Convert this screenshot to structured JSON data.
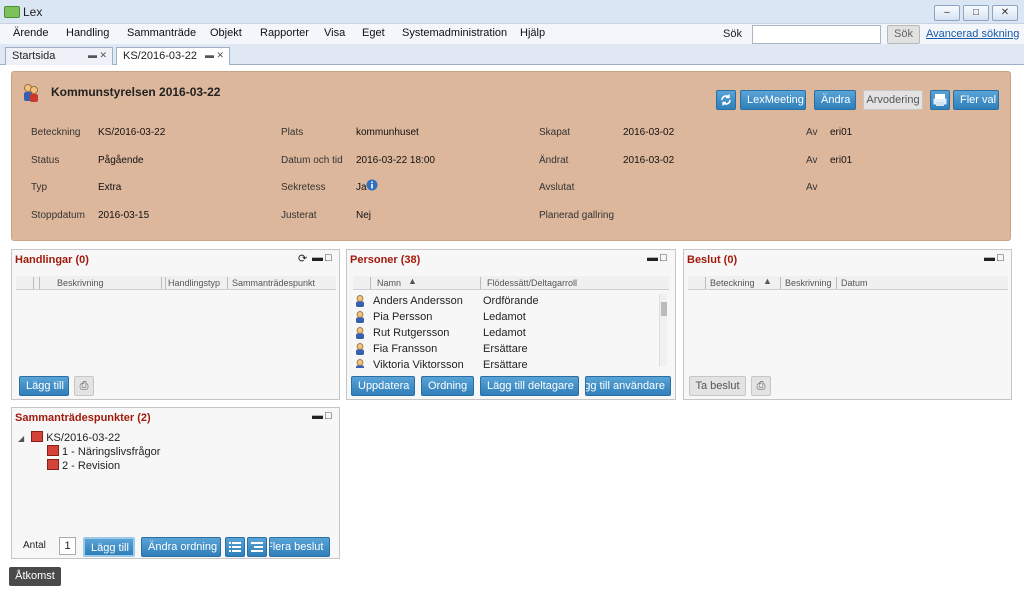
{
  "window": {
    "title": "Lex"
  },
  "menu": [
    "Ärende",
    "Handling",
    "Sammanträde",
    "Objekt",
    "Rapporter",
    "Visa",
    "Eget",
    "Systemadministration",
    "Hjälp"
  ],
  "search": {
    "label": "Sök",
    "value": "",
    "button": "Sök",
    "advanced": "Avancerad sökning"
  },
  "tabs": [
    "Startsida",
    "KS/2016-03-22"
  ],
  "header": {
    "title": "Kommunstyrelsen 2016-03-22",
    "buttons": {
      "lexmeeting": "LexMeeting",
      "andra": "Ändra",
      "arvodering": "Arvodering",
      "flerval": "Fler val"
    },
    "fields": {
      "beteckning": {
        "label": "Beteckning",
        "value": "KS/2016-03-22"
      },
      "status": {
        "label": "Status",
        "value": "Pågående"
      },
      "typ": {
        "label": "Typ",
        "value": "Extra"
      },
      "stoppdatum": {
        "label": "Stoppdatum",
        "value": "2016-03-15"
      },
      "plats": {
        "label": "Plats",
        "value": "kommunhuset"
      },
      "datum": {
        "label": "Datum och tid",
        "value": "2016-03-22 18:00"
      },
      "sekretess": {
        "label": "Sekretess",
        "value": "Ja"
      },
      "justerat": {
        "label": "Justerat",
        "value": "Nej"
      },
      "skapat": {
        "label": "Skapat",
        "value": "2016-03-02"
      },
      "andrat": {
        "label": "Ändrat",
        "value": "2016-03-02"
      },
      "avslutat": {
        "label": "Avslutat",
        "value": ""
      },
      "gallring": {
        "label": "Planerad gallring",
        "value": ""
      },
      "av1": {
        "label": "Av",
        "value": "eri01"
      },
      "av2": {
        "label": "Av",
        "value": "eri01"
      },
      "av3": {
        "label": "Av",
        "value": ""
      }
    }
  },
  "handlingar": {
    "title": "Handlingar (0)",
    "columns": [
      "Beskrivning",
      "Handlingstyp",
      "Sammanträdespunkt"
    ],
    "add_button": "Lägg till"
  },
  "personer": {
    "title": "Personer (38)",
    "columns": [
      "Namn",
      "Flödessätt/Deltagarroll"
    ],
    "rows": [
      {
        "name": "Anders Andersson",
        "role": "Ordförande"
      },
      {
        "name": "Pia Persson",
        "role": "Ledamot"
      },
      {
        "name": "Rut Rutgersson",
        "role": "Ledamot"
      },
      {
        "name": "Fia Fransson",
        "role": "Ersättare"
      },
      {
        "name": "Viktoria Viktorsson",
        "role": "Ersättare"
      }
    ],
    "buttons": {
      "uppdatera": "Uppdatera",
      "ordning": "Ordning",
      "deltagare": "Lägg till deltagare",
      "anvandare": "Lägg till användare"
    }
  },
  "beslut": {
    "title": "Beslut (0)",
    "columns": [
      "Beteckning",
      "Beskrivning",
      "Datum"
    ],
    "button": "Ta beslut"
  },
  "punkter": {
    "title": "Sammanträdespunkter (2)",
    "root": "KS/2016-03-22",
    "items": [
      "1 - Näringslivsfrågor",
      "2 - Revision"
    ],
    "antal_label": "Antal",
    "antal_value": "1",
    "buttons": {
      "add": "Lägg till",
      "order": "Ändra ordning",
      "multi": "Flera beslut"
    }
  },
  "footer": {
    "atkomst": "Åtkomst"
  },
  "colors": {
    "header_bg": "#ddb79c",
    "panel_title": "#a11b0d",
    "button_blue": "#2f7fba"
  }
}
